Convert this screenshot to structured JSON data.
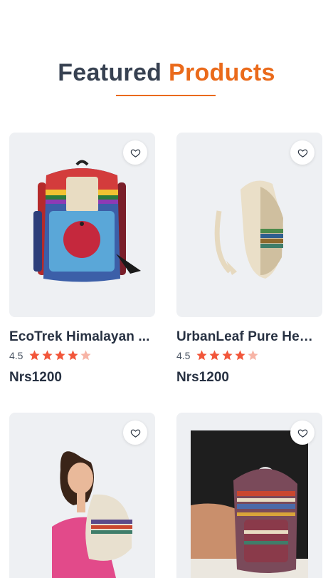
{
  "section": {
    "title_part1": "Featured",
    "title_part2": "Products"
  },
  "colors": {
    "accent": "#ea6a1b",
    "star_filled": "#f2563a",
    "star_empty": "#f7b4a6"
  },
  "products": [
    {
      "name": "EcoTrek Himalayan ...",
      "rating": "4.5",
      "price": "Nrs1200",
      "wishlist_icon": "heart-outline-icon"
    },
    {
      "name": "UrbanLeaf Pure Hem...",
      "rating": "4.5",
      "price": "Nrs1200",
      "wishlist_icon": "heart-outline-icon"
    },
    {
      "name": "",
      "rating": "",
      "price": "",
      "wishlist_icon": "heart-outline-icon"
    },
    {
      "name": "",
      "rating": "",
      "price": "",
      "wishlist_icon": "heart-outline-icon"
    }
  ]
}
